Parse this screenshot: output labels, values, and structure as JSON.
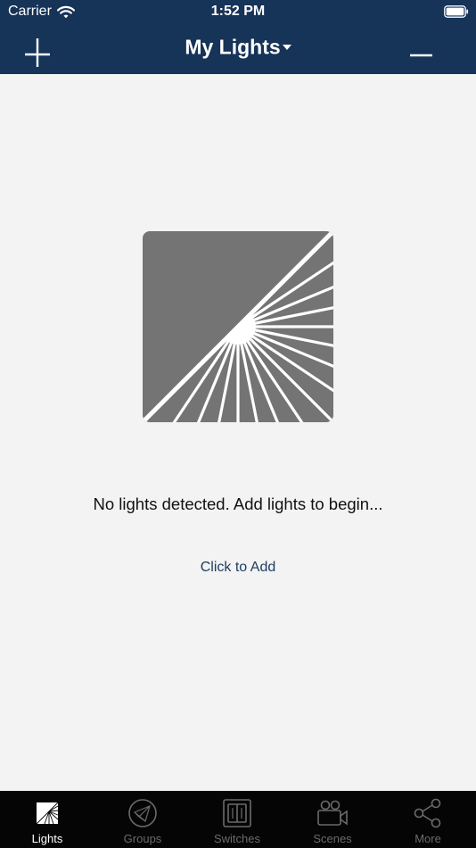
{
  "status_bar": {
    "carrier": "Carrier",
    "time": "1:52 PM",
    "wifi_icon": "wifi-icon",
    "battery_icon": "battery-full-icon"
  },
  "nav": {
    "title": "My Lights",
    "add_icon": "plus-icon",
    "remove_icon": "minus-icon",
    "dropdown_icon": "caret-down-icon"
  },
  "empty_state": {
    "illustration_icon": "light-rays-icon",
    "message": "No lights detected. Add lights to begin...",
    "action_label": "Click to Add"
  },
  "tabbar": {
    "tabs": [
      {
        "label": "Lights",
        "icon": "lights-icon",
        "active": true
      },
      {
        "label": "Groups",
        "icon": "groups-icon",
        "active": false
      },
      {
        "label": "Switches",
        "icon": "switches-icon",
        "active": false
      },
      {
        "label": "Scenes",
        "icon": "scenes-icon",
        "active": false
      },
      {
        "label": "More",
        "icon": "share-icon",
        "active": false
      }
    ]
  },
  "colors": {
    "header_bg": "#163358",
    "content_bg": "#f3f3f3",
    "link": "#1e3c60",
    "tabbar_bg": "#050505",
    "tab_inactive": "#6b6b6b",
    "tab_active": "#ffffff",
    "illustration": "#747474"
  }
}
